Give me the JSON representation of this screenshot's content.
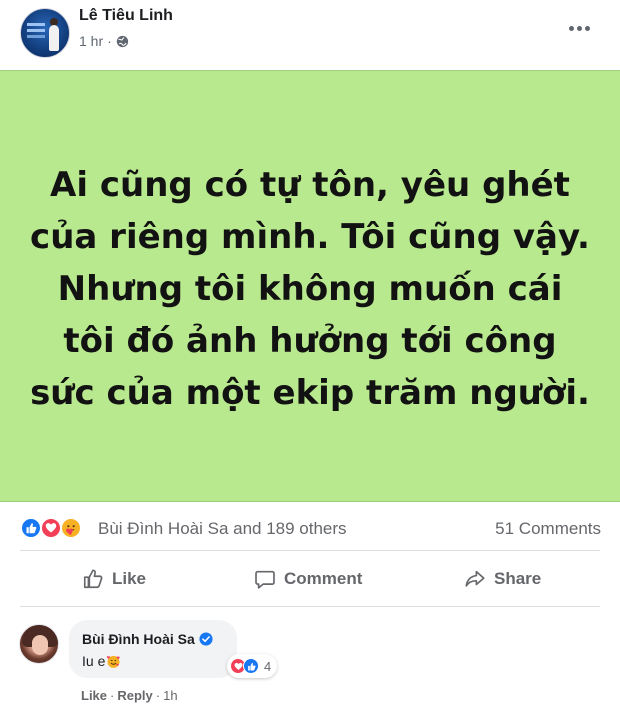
{
  "post": {
    "author": "Lê Tiêu Linh",
    "time": "1 hr",
    "separator": "·",
    "text": "Ai cũng có tự tôn, yêu ghét của riêng mình. Tôi cũng vậy. Nhưng tôi không muốn cái tôi đó ảnh hưởng tới công sức của một ekip trăm người.",
    "image_background": "#b8e98e"
  },
  "reactions": {
    "icons": [
      "like-icon",
      "love-icon",
      "care-icon"
    ],
    "summary": "Bùi Đình Hoài Sa and 189 others",
    "comments_count": "51 Comments"
  },
  "actions": {
    "like": "Like",
    "comment": "Comment",
    "share": "Share"
  },
  "comment": {
    "author": "Bùi Đình Hoài Sa",
    "verified": true,
    "text": "Iu e",
    "emoji": "smiling-face-with-hearts",
    "reaction_count": "4",
    "like_label": "Like",
    "reply_label": "Reply",
    "dot": "·",
    "time": "1h"
  },
  "colors": {
    "accent": "#1877f2",
    "love": "#f33e58",
    "care": "#f7b125",
    "secondary_text": "#65676b"
  }
}
